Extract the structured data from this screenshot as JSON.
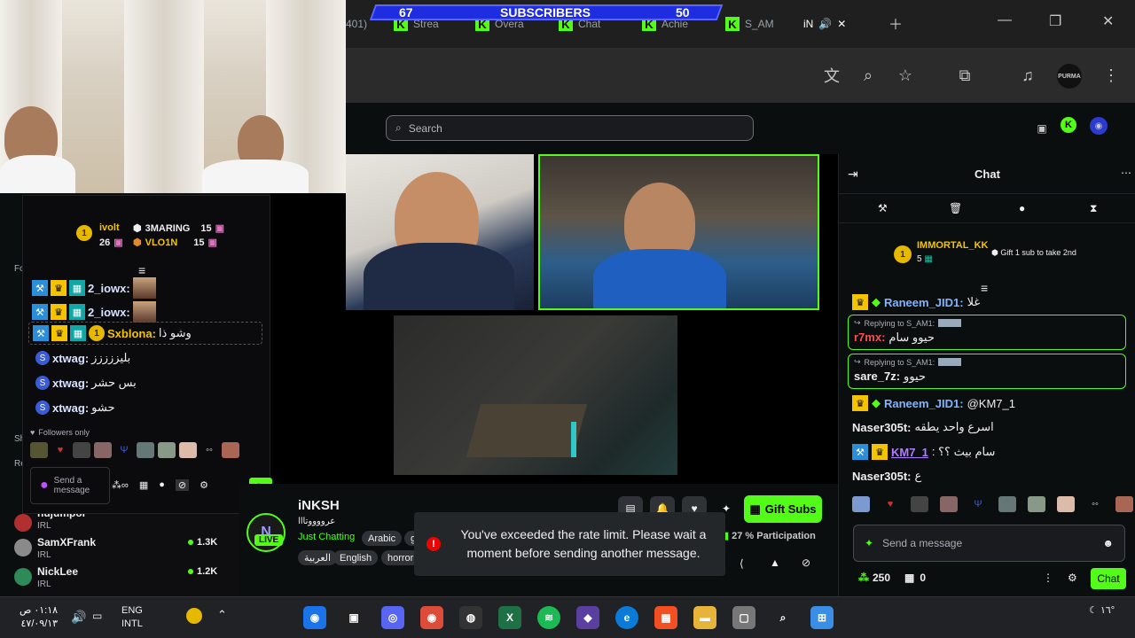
{
  "overlay": {
    "sub_left": "67",
    "sub_title": "SUBSCRIBERS",
    "sub_right": "50",
    "tabs": [
      "401)",
      "Strea",
      "Overa",
      "Chat",
      "Achie",
      "S_AM",
      "iN"
    ],
    "profile_label": "PURMA"
  },
  "kick": {
    "search_placeholder": "Search"
  },
  "left_chat": {
    "leaderboard": [
      {
        "rank": "1",
        "name": "ivolt",
        "count": "26"
      },
      {
        "name": "3MARING",
        "count": "15"
      },
      {
        "name": "VLO1N",
        "count": "15"
      }
    ],
    "messages": [
      {
        "name": "2_iowx:",
        "text": ""
      },
      {
        "name": "2_iowx:",
        "text": ""
      },
      {
        "name": "Sxblona:",
        "text": "وشو ذا",
        "rank": "1"
      },
      {
        "name": "xtwag:",
        "text": "بليززززز"
      },
      {
        "name": "xtwag:",
        "text": "بس حشر"
      },
      {
        "name": "xtwag:",
        "text": "حشو"
      }
    ],
    "followers_only": "Followers only",
    "send_placeholder": "Send a message",
    "chat_button": "Chat"
  },
  "left_nav": {
    "labels": [
      "Fo",
      "Sh",
      "Re"
    ],
    "items": [
      {
        "name": "nujumpor",
        "cat": "IRL",
        "viewers": "1.3K"
      },
      {
        "name": "SamXFrank",
        "cat": "IRL",
        "viewers": "1.3K"
      },
      {
        "name": "NickLee",
        "cat": "IRL",
        "viewers": "1.2K"
      }
    ]
  },
  "channel": {
    "name": "iNKSH",
    "title": "عرووووتااا",
    "category": "Just Chatting",
    "live_badge": "LIVE",
    "tags": [
      "Arabic",
      "g",
      "العربية",
      "English",
      "horror"
    ],
    "gift_subs": "Gift Subs",
    "participation": "27 % Participation"
  },
  "toast": {
    "message": "You've exceeded the rate limit. Please wait a moment before sending another message."
  },
  "chat": {
    "title": "Chat",
    "pinned_user": "IMMORTAL_KK",
    "pinned_rank": "1",
    "pinned_count": "5",
    "pinned_hint": "Gift 1 sub to take 2nd",
    "messages": [
      {
        "name": "Raneem_JID1:",
        "color": "#7fb5ff",
        "text": "غلا"
      },
      {
        "reply_to": "Replying to S_AM1:",
        "name": "r7mx:",
        "color": "#ff4d4d",
        "text": "حيوو سام"
      },
      {
        "reply_to": "Replying to S_AM1:",
        "name": "sare_7z:",
        "color": "#efeff1",
        "text": "حيوو"
      },
      {
        "name": "Raneem_JID1:",
        "color": "#7fb5ff",
        "text": "@KM7_1"
      },
      {
        "name": "Naser305t:",
        "color": "#efeff1",
        "text": "اسرع واحد يطقه"
      },
      {
        "name": "KM7_1",
        "color": "#b07cff",
        "text": ": سام بيث ؟؟"
      },
      {
        "name": "Naser305t:",
        "color": "#efeff1",
        "text": "ع"
      }
    ],
    "send_placeholder": "Send a message",
    "points": "250",
    "gifts": "0",
    "chat_button": "Chat"
  },
  "taskbar": {
    "time": "٠١:١٨ ص",
    "date": "٤٧/٠٩/١٣",
    "lang": "ENG",
    "lang2": "INTL",
    "weather": "١٦°"
  }
}
